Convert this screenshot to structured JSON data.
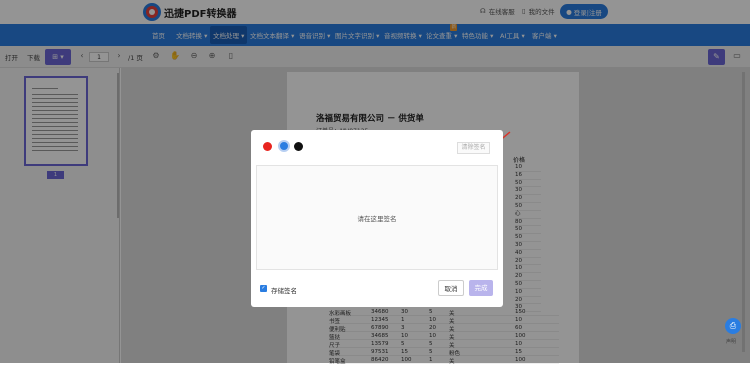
{
  "app": {
    "name": "迅捷PDF转换器"
  },
  "topbar": {
    "online_service": "在线客服",
    "my_files": "我的文件",
    "login": "登录|注册"
  },
  "nav": {
    "items": [
      "首页",
      "文档转换",
      "文档处理",
      "文档文本翻译",
      "语音识别",
      "图片文字识别",
      "音视频转换",
      "论文查重",
      "特色功能",
      "AI工具",
      "客户端"
    ],
    "active_index": 2,
    "badge": "新"
  },
  "toolbar": {
    "open": "打开",
    "download": "下载",
    "page_input": "1",
    "page_total": "/1 页"
  },
  "sidebar": {
    "page_label": "1"
  },
  "document": {
    "title": "洛福贸易有限公司 － 供货单",
    "order_no": "订单号：MV87125",
    "price_header": "价格",
    "prices": [
      "10",
      "16",
      "50",
      "30",
      "20",
      "50",
      "心",
      "80",
      "50",
      "50",
      "30",
      "40",
      "20",
      "10",
      "20",
      "50",
      "10",
      "20",
      "30"
    ],
    "rows": [
      [
        "水彩画板",
        "34680",
        "30",
        "5",
        "关"
      ],
      [
        "书签",
        "12345",
        "1",
        "10",
        "关"
      ],
      [
        "便利贴",
        "67890",
        "3",
        "20",
        "关"
      ],
      [
        "篮挞",
        "34685",
        "10",
        "10",
        "关"
      ],
      [
        "尺子",
        "13579",
        "5",
        "5",
        "关"
      ],
      [
        "笔袋",
        "97531",
        "15",
        "5",
        "粉色"
      ],
      [
        "铅笔盒",
        "86420",
        "100",
        "1",
        "关"
      ]
    ],
    "row_last_prices": [
      "150",
      "10",
      "60",
      "100",
      "10",
      "15",
      "100"
    ]
  },
  "dialog": {
    "clear_label": "清除签名",
    "placeholder": "请在这里签名",
    "save_label": "存储签名",
    "cancel_label": "取消",
    "confirm_label": "完成",
    "colors": [
      "#e8251f",
      "#2a7de1",
      "#111111"
    ]
  },
  "fab": {
    "label": "声明"
  }
}
